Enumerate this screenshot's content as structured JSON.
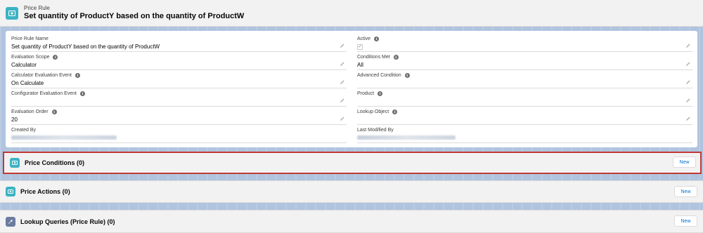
{
  "header": {
    "object_label": "Price Rule",
    "record_title": "Set quantity of ProductY based on the quantity of ProductW"
  },
  "fields_left": [
    {
      "label": "Price Rule Name",
      "value": "Set quantity of ProductY based on the quantity of ProductW",
      "info": false
    },
    {
      "label": "Evaluation Scope",
      "value": "Calculator",
      "info": true
    },
    {
      "label": "Calculator Evaluation Event",
      "value": "On Calculate",
      "info": true
    },
    {
      "label": "Configurator Evaluation Event",
      "value": "",
      "info": true
    },
    {
      "label": "Evaluation Order",
      "value": "20",
      "info": true
    },
    {
      "label": "Created By",
      "value": "",
      "info": false
    }
  ],
  "fields_right": [
    {
      "label": "Active",
      "value": "",
      "info": true
    },
    {
      "label": "Conditions Met",
      "value": "All",
      "info": true
    },
    {
      "label": "Advanced Condition",
      "value": "",
      "info": true
    },
    {
      "label": "Product",
      "value": "",
      "info": true
    },
    {
      "label": "Lookup Object",
      "value": "",
      "info": true
    },
    {
      "label": "Last Modified By",
      "value": "",
      "info": false
    }
  ],
  "active_checked": true,
  "related_lists": [
    {
      "title": "Price Conditions (0)",
      "button": "New",
      "icon": "price-tag-icon"
    },
    {
      "title": "Price Actions (0)",
      "button": "New",
      "icon": "price-tag-icon"
    },
    {
      "title": "Lookup Queries (Price Rule) (0)",
      "button": "New",
      "icon": "wrench-icon"
    }
  ],
  "icons": {
    "header": "price-rule-icon",
    "info": "info-icon",
    "edit": "pencil-icon"
  },
  "colors": {
    "icon_teal": "#3bb3c3",
    "highlight_border": "#c23934",
    "link_blue": "#0070d2"
  }
}
